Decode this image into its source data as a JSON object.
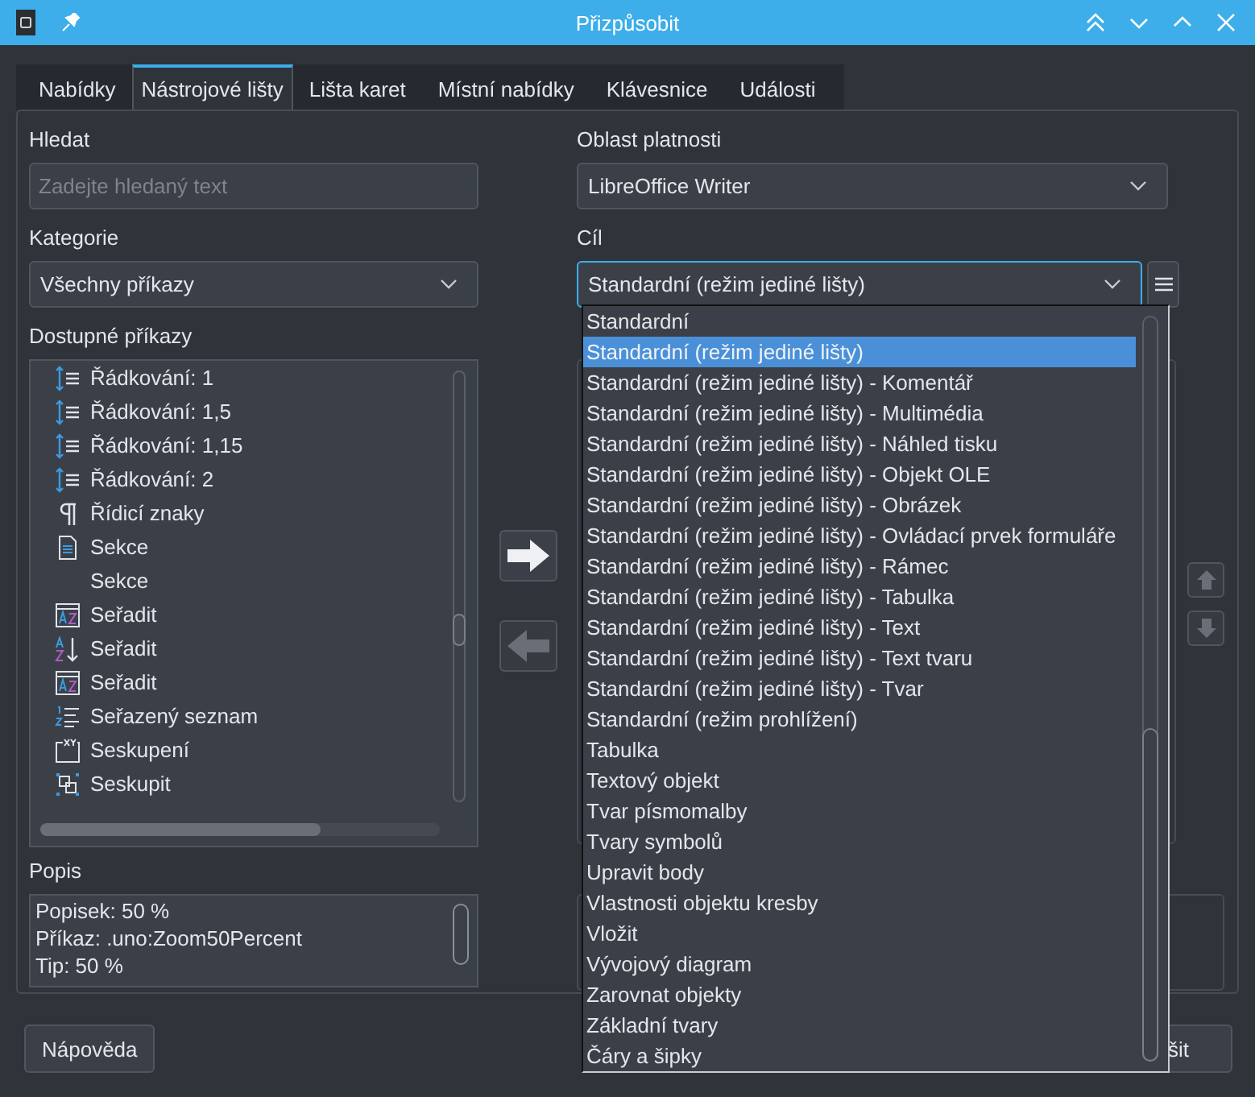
{
  "window": {
    "title": "Přizpůsobit"
  },
  "tabs": [
    {
      "label": "Nabídky",
      "selected": false
    },
    {
      "label": "Nástrojové lišty",
      "selected": true
    },
    {
      "label": "Lišta karet",
      "selected": false
    },
    {
      "label": "Místní nabídky",
      "selected": false
    },
    {
      "label": "Klávesnice",
      "selected": false
    },
    {
      "label": "Události",
      "selected": false
    }
  ],
  "search": {
    "label": "Hledat",
    "placeholder": "Zadejte hledaný text"
  },
  "category": {
    "label": "Kategorie",
    "value": "Všechny příkazy"
  },
  "available_commands": {
    "label": "Dostupné příkazy",
    "items": [
      {
        "kind": "line-spacing",
        "label": "Řádkování: 1"
      },
      {
        "kind": "line-spacing",
        "label": "Řádkování: 1,5"
      },
      {
        "kind": "line-spacing",
        "label": "Řádkování: 1,15"
      },
      {
        "kind": "line-spacing",
        "label": "Řádkování: 2"
      },
      {
        "kind": "pilcrow",
        "label": "Řídicí znaky"
      },
      {
        "kind": "document",
        "label": "Sekce"
      },
      {
        "kind": "plain",
        "label": "Sekce"
      },
      {
        "kind": "sort-box",
        "label": "Seřadit"
      },
      {
        "kind": "sort-arrow",
        "label": "Seřadit"
      },
      {
        "kind": "sort-box",
        "label": "Seřadit"
      },
      {
        "kind": "numbered-list",
        "label": "Seřazený seznam"
      },
      {
        "kind": "xy-frame",
        "label": "Seskupení"
      },
      {
        "kind": "group",
        "label": "Seskupit"
      }
    ]
  },
  "description": {
    "label": "Popis",
    "lines": [
      "Popisek: 50 %",
      "Příkaz: .uno:Zoom50Percent",
      "Tip: 50 %"
    ]
  },
  "transfer_buttons": [
    {
      "kind": "add",
      "disabled": false
    },
    {
      "kind": "remove",
      "disabled": true
    }
  ],
  "scope": {
    "label": "Oblast platnosti",
    "value": "LibreOffice Writer"
  },
  "target": {
    "label": "Cíl",
    "value": "Standardní (režim jediné lišty)",
    "open": true,
    "options": [
      {
        "label": "Standardní",
        "selected": false
      },
      {
        "label": "Standardní (režim jediné lišty)",
        "selected": true
      },
      {
        "label": "Standardní (režim jediné lišty) - Komentář",
        "selected": false
      },
      {
        "label": "Standardní (režim jediné lišty) - Multimédia",
        "selected": false
      },
      {
        "label": "Standardní (režim jediné lišty) - Náhled tisku",
        "selected": false
      },
      {
        "label": "Standardní (režim jediné lišty) - Objekt OLE",
        "selected": false
      },
      {
        "label": "Standardní (režim jediné lišty) - Obrázek",
        "selected": false
      },
      {
        "label": "Standardní (režim jediné lišty) - Ovládací prvek formuláře",
        "selected": false
      },
      {
        "label": "Standardní (režim jediné lišty) - Rámec",
        "selected": false
      },
      {
        "label": "Standardní (režim jediné lišty) - Tabulka",
        "selected": false
      },
      {
        "label": "Standardní (režim jediné lišty) - Text",
        "selected": false
      },
      {
        "label": "Standardní (režim jediné lišty) - Text tvaru",
        "selected": false
      },
      {
        "label": "Standardní (režim jediné lišty) - Tvar",
        "selected": false
      },
      {
        "label": "Standardní (režim prohlížení)",
        "selected": false
      },
      {
        "label": "Tabulka",
        "selected": false
      },
      {
        "label": "Textový objekt",
        "selected": false
      },
      {
        "label": "Tvar písmomalby",
        "selected": false
      },
      {
        "label": "Tvary symbolů",
        "selected": false
      },
      {
        "label": "Upravit body",
        "selected": false
      },
      {
        "label": "Vlastnosti objektu kresby",
        "selected": false
      },
      {
        "label": "Vložit",
        "selected": false
      },
      {
        "label": "Vývojový diagram",
        "selected": false
      },
      {
        "label": "Zarovnat objekty",
        "selected": false
      },
      {
        "label": "Základní tvary",
        "selected": false
      },
      {
        "label": "Čáry a šipky",
        "selected": false
      }
    ]
  },
  "move_buttons": [
    {
      "kind": "up",
      "disabled": true
    },
    {
      "kind": "down",
      "disabled": true
    }
  ],
  "buttons": [
    "Nápověda",
    "šit"
  ]
}
